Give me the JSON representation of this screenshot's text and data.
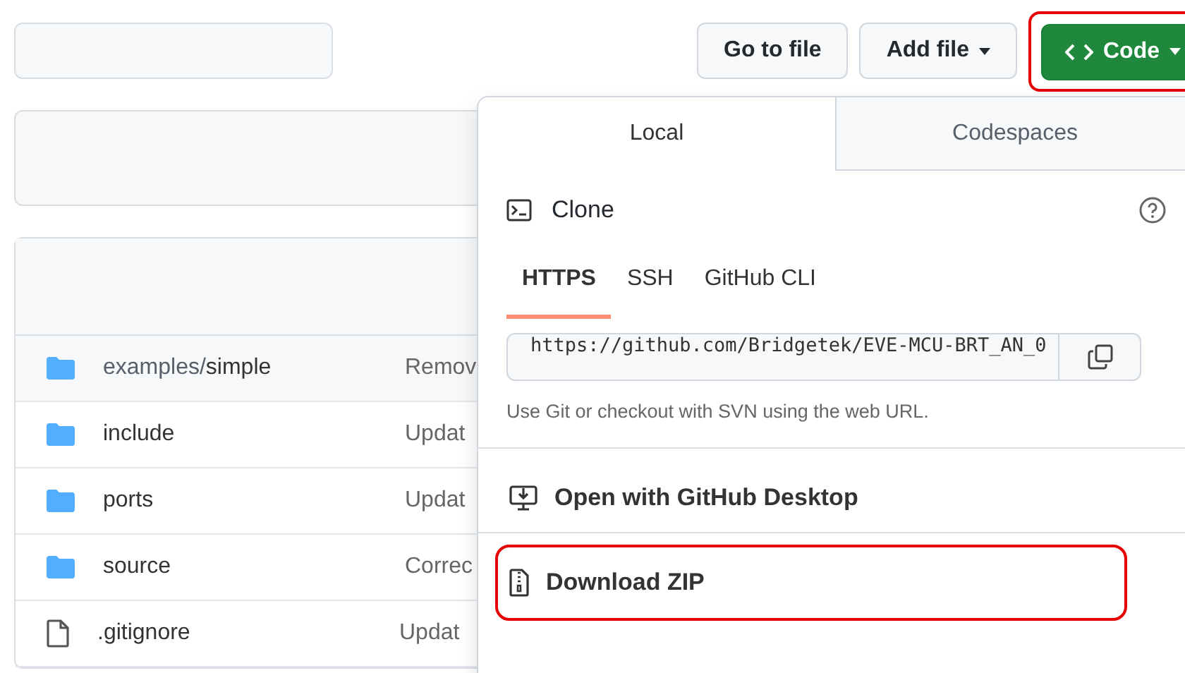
{
  "toolbar": {
    "buttons": [
      {
        "label": "Go to file",
        "kind": "plain",
        "caret": false,
        "highlighted": false
      },
      {
        "label": "Add file",
        "kind": "plain",
        "caret": true,
        "highlighted": false
      },
      {
        "label": "Code",
        "kind": "primary",
        "caret": true,
        "highlighted": true
      }
    ]
  },
  "files": [
    {
      "kind": "folder",
      "prefix": "examples/",
      "name": "simple",
      "message": "Remov"
    },
    {
      "kind": "folder",
      "name": "include",
      "message": "Updat"
    },
    {
      "kind": "folder",
      "name": "ports",
      "message": "Updat"
    },
    {
      "kind": "folder",
      "name": "source",
      "message": "Correc"
    },
    {
      "kind": "file",
      "name": ".gitignore",
      "message": "Updat"
    }
  ],
  "dropdown": {
    "tabs": [
      {
        "label": "Local",
        "selected": true
      },
      {
        "label": "Codespaces",
        "selected": false
      }
    ],
    "clone_title": "Clone",
    "protocols": [
      {
        "label": "HTTPS",
        "selected": true
      },
      {
        "label": "SSH",
        "selected": false
      },
      {
        "label": "GitHub CLI",
        "selected": false
      }
    ],
    "url": "https://github.com/Bridgetek/EVE-MCU-BRT_AN_0",
    "hint": "Use Git or checkout with SVN using the web URL.",
    "actions": [
      {
        "kind": "desktop",
        "label": "Open with GitHub Desktop",
        "highlighted": false
      },
      {
        "kind": "zip",
        "label": "Download ZIP",
        "highlighted": true
      }
    ]
  }
}
